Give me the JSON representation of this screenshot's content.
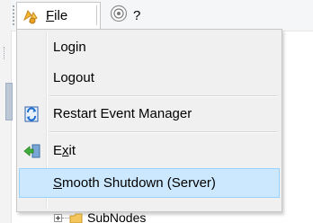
{
  "menubar": {
    "file_label_mnemonic": "F",
    "file_label_rest": "ile",
    "help_label": "?"
  },
  "file_menu": {
    "items": [
      {
        "label": "Login",
        "icon": null
      },
      {
        "label": "Logout",
        "icon": null
      },
      {
        "label": "Restart Event Manager",
        "icon": "restart-icon"
      },
      {
        "label_mnemonic": "x",
        "label_pre": "E",
        "label_post": "it",
        "icon": "exit-icon"
      },
      {
        "label_mnemonic": "S",
        "label_post": "mooth Shutdown (Server)",
        "icon": null,
        "highlighted": true
      }
    ]
  },
  "tree": {
    "visible_node_label": "SubNodes"
  },
  "colors": {
    "highlight_bg": "#cce8ff",
    "highlight_border": "#99d1ff",
    "menu_bg": "#f0f0f0"
  }
}
